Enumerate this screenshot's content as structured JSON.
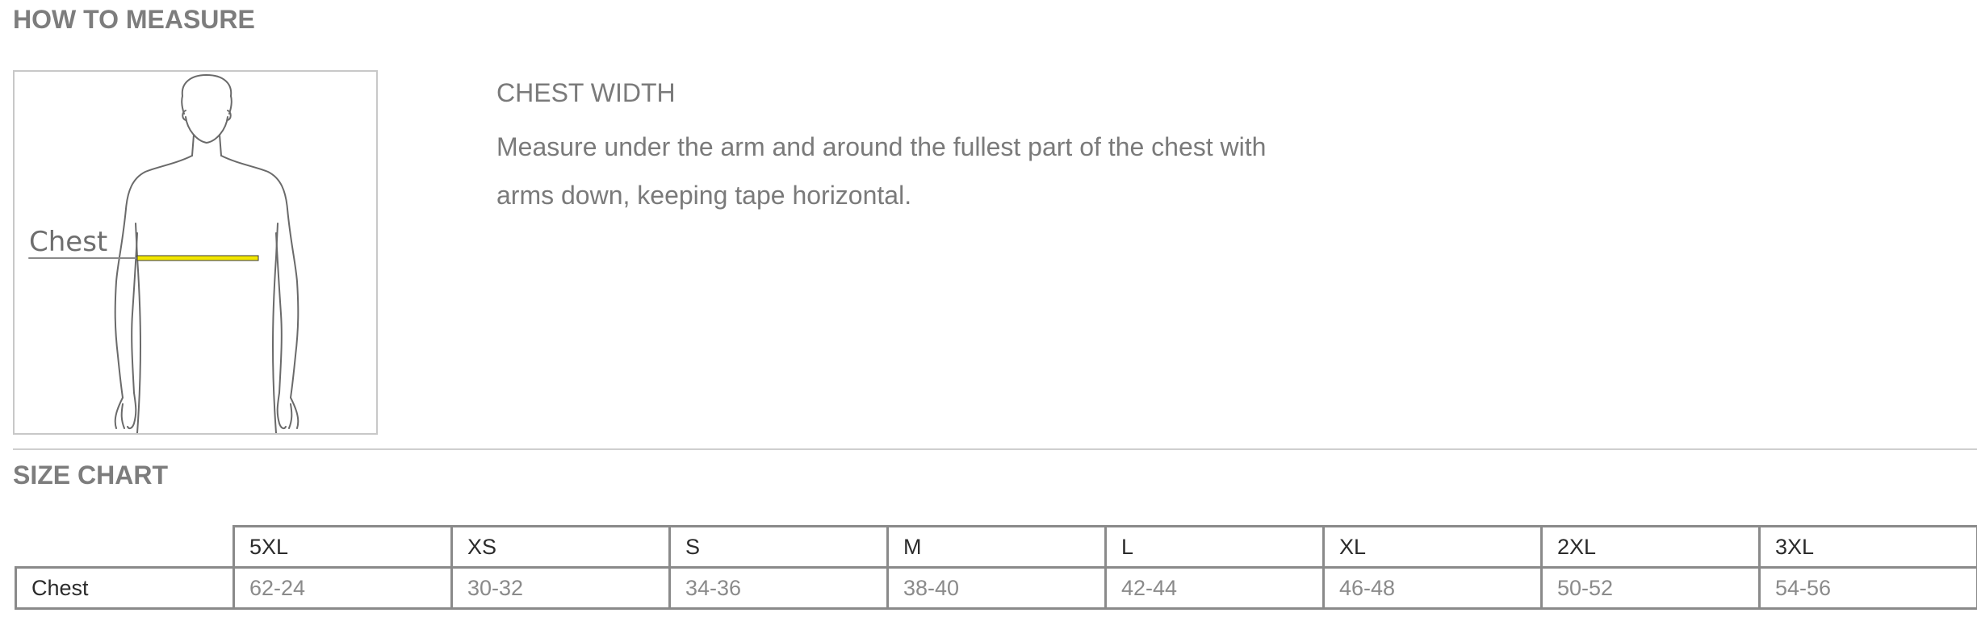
{
  "how_to_measure": {
    "title": "HOW TO MEASURE",
    "figure_label": "Chest",
    "heading": "CHEST WIDTH",
    "text": "Measure under the arm and around the fullest part of the chest with arms down, keeping tape horizontal."
  },
  "size_chart": {
    "title": "SIZE CHART",
    "sizes": [
      "5XL",
      "XS",
      "S",
      "M",
      "L",
      "XL",
      "2XL",
      "3XL"
    ],
    "rows": [
      {
        "label": "Chest",
        "values": [
          "62-24",
          "30-32",
          "34-36",
          "38-40",
          "42-44",
          "46-48",
          "50-52",
          "54-56"
        ]
      }
    ]
  },
  "colors": {
    "tape": "#f2e600",
    "text_gray": "#7a7a7a",
    "border": "#8a8a8a"
  }
}
